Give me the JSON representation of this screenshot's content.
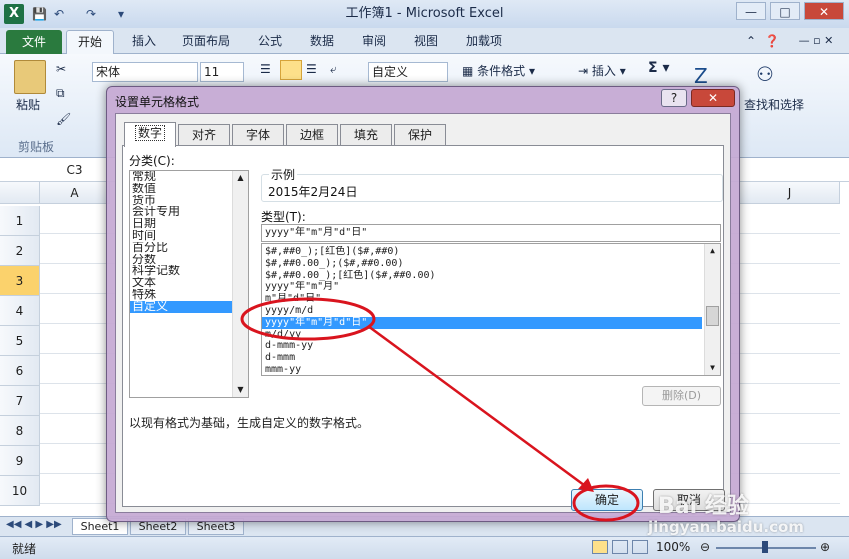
{
  "window": {
    "title": "工作簿1 - Microsoft Excel",
    "app_icon": "X",
    "minimize": "—",
    "maximize": "□",
    "close": "✕"
  },
  "ribbon": {
    "tabs": [
      "文件",
      "开始",
      "插入",
      "页面布局",
      "公式",
      "数据",
      "审阅",
      "视图",
      "加载项"
    ],
    "font_name": "宋体",
    "font_size": "11",
    "number_format": "自定义",
    "paste_label": "粘贴",
    "clipboard_label": "剪贴板",
    "cond_format": "条件格式",
    "insert": "插入",
    "find_select": "查找和选择"
  },
  "namebox": "C3",
  "sheet": {
    "columns": [
      "A",
      "J"
    ],
    "rows": [
      "1",
      "2",
      "3",
      "4",
      "5",
      "6",
      "7",
      "8",
      "9",
      "10"
    ],
    "tabs": [
      "Sheet1",
      "Sheet2",
      "Sheet3"
    ]
  },
  "status": {
    "ready": "就绪",
    "zoom": "100%"
  },
  "dialog": {
    "title": "设置单元格格式",
    "help": "?",
    "close": "✕",
    "tabs": [
      "数字",
      "对齐",
      "字体",
      "边框",
      "填充",
      "保护"
    ],
    "category_label": "分类(C):",
    "categories": [
      "常规",
      "数值",
      "货币",
      "会计专用",
      "日期",
      "时间",
      "百分比",
      "分数",
      "科学记数",
      "文本",
      "特殊",
      "自定义"
    ],
    "sample_label": "示例",
    "sample_value": "2015年2月24日",
    "type_label": "类型(T):",
    "type_value": "yyyy\"年\"m\"月\"d\"日\"",
    "formats": [
      "$#,##0_);[红色]($#,##0)",
      "$#,##0.00_);($#,##0.00)",
      "$#,##0.00_);[红色]($#,##0.00)",
      "yyyy\"年\"m\"月\"",
      "m\"月\"d\"日\"",
      "yyyy/m/d",
      "yyyy\"年\"m\"月\"d\"日\"",
      "m/d/yy",
      "d-mmm-yy",
      "d-mmm",
      "mmm-yy"
    ],
    "delete_label": "删除(D)",
    "description": "以现有格式为基础，生成自定义的数字格式。",
    "ok_label": "确定",
    "cancel_label": "取消"
  },
  "watermark": {
    "brand": "Bai 经验",
    "url": "jingyan.baidu.com"
  },
  "colors": {
    "highlight": "#3399ff",
    "annotation": "#d9141e",
    "file_tab": "#2a7a3e"
  }
}
